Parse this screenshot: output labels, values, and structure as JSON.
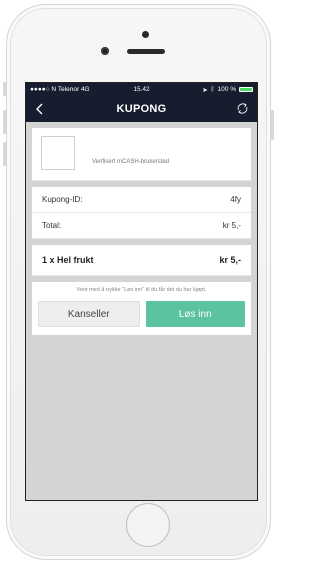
{
  "status_bar": {
    "carrier": "●●●●○ N Telenor  4G",
    "time": "15.42",
    "battery": "100 %",
    "battery_level": 1.0
  },
  "nav": {
    "title": "KUPONG",
    "back_icon": "chevron-left-icon",
    "refresh_icon": "refresh-icon"
  },
  "merchant": {
    "verified_label": "Verifisert mCASH-brukersted"
  },
  "coupon": {
    "id_label": "Kupong-ID:",
    "id_value": "4fy",
    "total_label": "Total:",
    "total_value": "kr 5,-"
  },
  "item": {
    "name": "1 x Hel frukt",
    "price": "kr 5,-"
  },
  "hint": "Vent med å trykke \"Løs inn\" til du får det du har kjøpt.",
  "actions": {
    "cancel_label": "Kanseller",
    "redeem_label": "Løs inn"
  },
  "colors": {
    "navbar": "#151d2e",
    "redeem": "#5bc3a2",
    "background": "#d4d4d4"
  }
}
